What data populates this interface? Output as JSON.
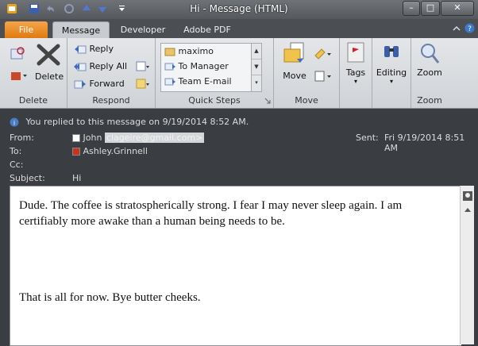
{
  "window": {
    "title": "Hi - Message (HTML)",
    "minimize_symbol": "–",
    "maximize_symbol": "□",
    "close_symbol": "✕"
  },
  "tabs": [
    "File",
    "Message",
    "Developer",
    "Adobe PDF"
  ],
  "ribbon": {
    "delete_group": {
      "label": "Delete",
      "delete_button": "Delete"
    },
    "respond_group": {
      "label": "Respond",
      "reply": "Reply",
      "reply_all": "Reply All",
      "forward": "Forward"
    },
    "quick_steps_group": {
      "label": "Quick Steps",
      "items": [
        "maximo",
        "To Manager",
        "Team E-mail"
      ]
    },
    "move_group": {
      "label": "Move",
      "move_button": "Move"
    },
    "tags_group": {
      "tags_button": "Tags"
    },
    "editing_group": {
      "editing_button": "Editing"
    },
    "zoom_group": {
      "label": "Zoom",
      "zoom_button": "Zoom"
    }
  },
  "header": {
    "info_bar": "You replied to this message on 9/19/2014 8:52 AM.",
    "from_label": "From:",
    "from_name": "John",
    "from_email": "clageire@gmail.com>",
    "to_label": "To:",
    "to_value": "Ashley.Grinnell",
    "cc_label": "Cc:",
    "subject_label": "Subject:",
    "subject_value": "Hi",
    "sent_label": "Sent:",
    "sent_value": "Fri 9/19/2014 8:51 AM"
  },
  "body": {
    "paragraph1": "Dude. The coffee is stratospherically strong. I fear I may never sleep again. I am certifiably more awake than a human being needs to be.",
    "paragraph2": "That is all for now. Bye butter cheeks."
  }
}
